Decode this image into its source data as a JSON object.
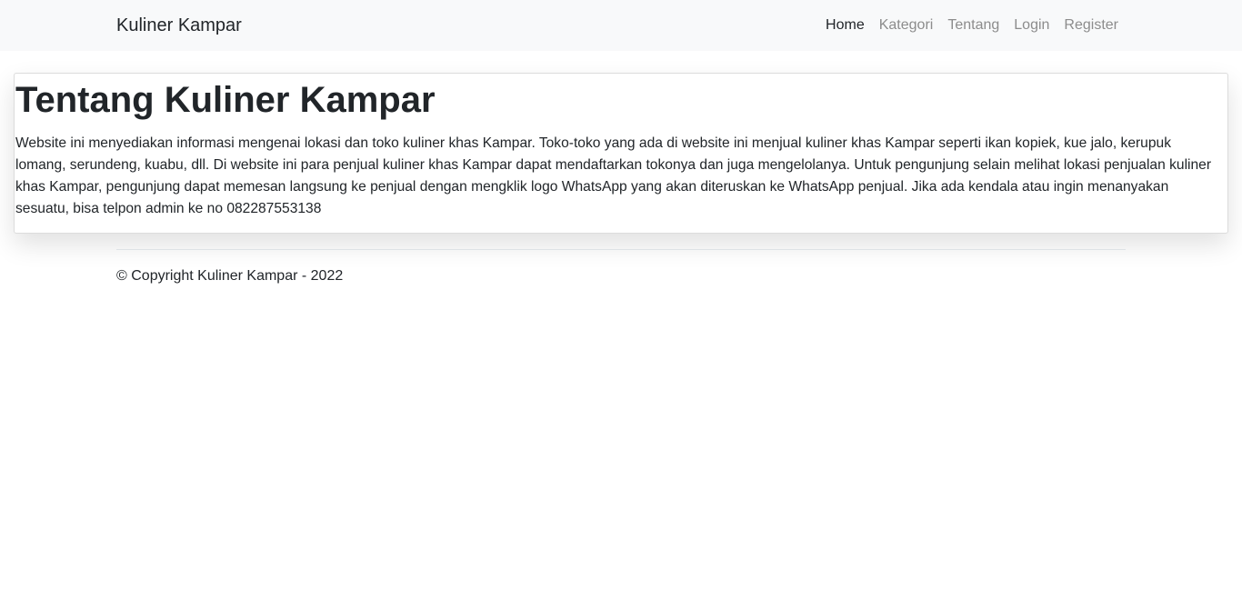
{
  "navbar": {
    "brand": "Kuliner Kampar",
    "links": [
      {
        "label": "Home",
        "active": true
      },
      {
        "label": "Kategori",
        "active": false
      },
      {
        "label": "Tentang",
        "active": false
      },
      {
        "label": "Login",
        "active": false
      },
      {
        "label": "Register",
        "active": false
      }
    ]
  },
  "main": {
    "title": "Tentang Kuliner Kampar",
    "description": "Website ini menyediakan informasi mengenai lokasi dan toko kuliner khas Kampar. Toko-toko yang ada di website ini menjual kuliner khas Kampar seperti ikan kopiek, kue jalo, kerupuk lomang, serundeng, kuabu, dll. Di website ini para penjual kuliner khas Kampar dapat mendaftarkan tokonya dan juga mengelolanya. Untuk pengunjung selain melihat lokasi penjualan kuliner khas Kampar, pengunjung dapat memesan langsung ke penjual dengan mengklik logo WhatsApp yang akan diteruskan ke WhatsApp penjual. Jika ada kendala atau ingin menanyakan sesuatu, bisa telpon admin ke no 082287553138"
  },
  "footer": {
    "copyright": "© Copyright Kuliner Kampar - 2022"
  },
  "colors": {
    "navbar_bg": "#f8f9fa",
    "text": "#212529",
    "nav_muted": "#8c8c8c"
  }
}
